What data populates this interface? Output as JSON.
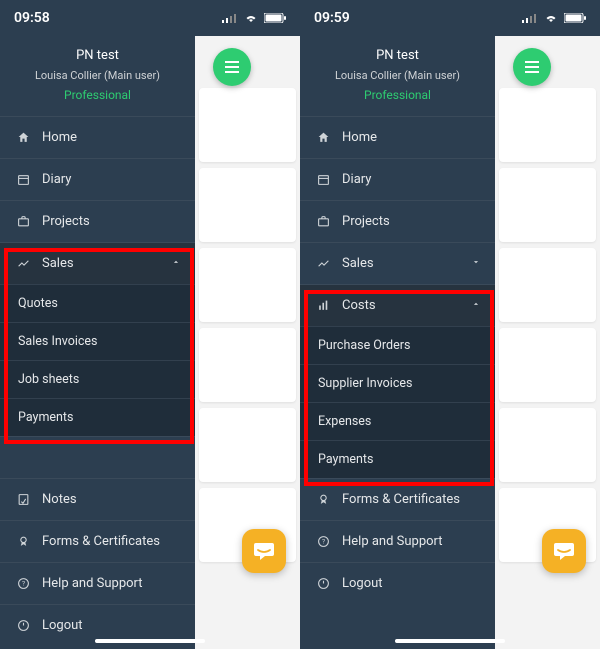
{
  "common": {
    "header": {
      "title": "PN test",
      "user": "Louisa Collier (Main user)",
      "plan": "Professional"
    },
    "menu": {
      "home": "Home",
      "diary": "Diary",
      "projects": "Projects",
      "sales": "Sales",
      "costs": "Costs",
      "notes": "Notes",
      "forms": "Forms & Certificates",
      "help": "Help and Support",
      "logout": "Logout"
    }
  },
  "left": {
    "time": "09:58",
    "sales_sub": [
      "Quotes",
      "Sales Invoices",
      "Job sheets",
      "Payments"
    ]
  },
  "right": {
    "time": "09:59",
    "costs_sub": [
      "Purchase Orders",
      "Supplier Invoices",
      "Expenses",
      "Payments"
    ]
  }
}
